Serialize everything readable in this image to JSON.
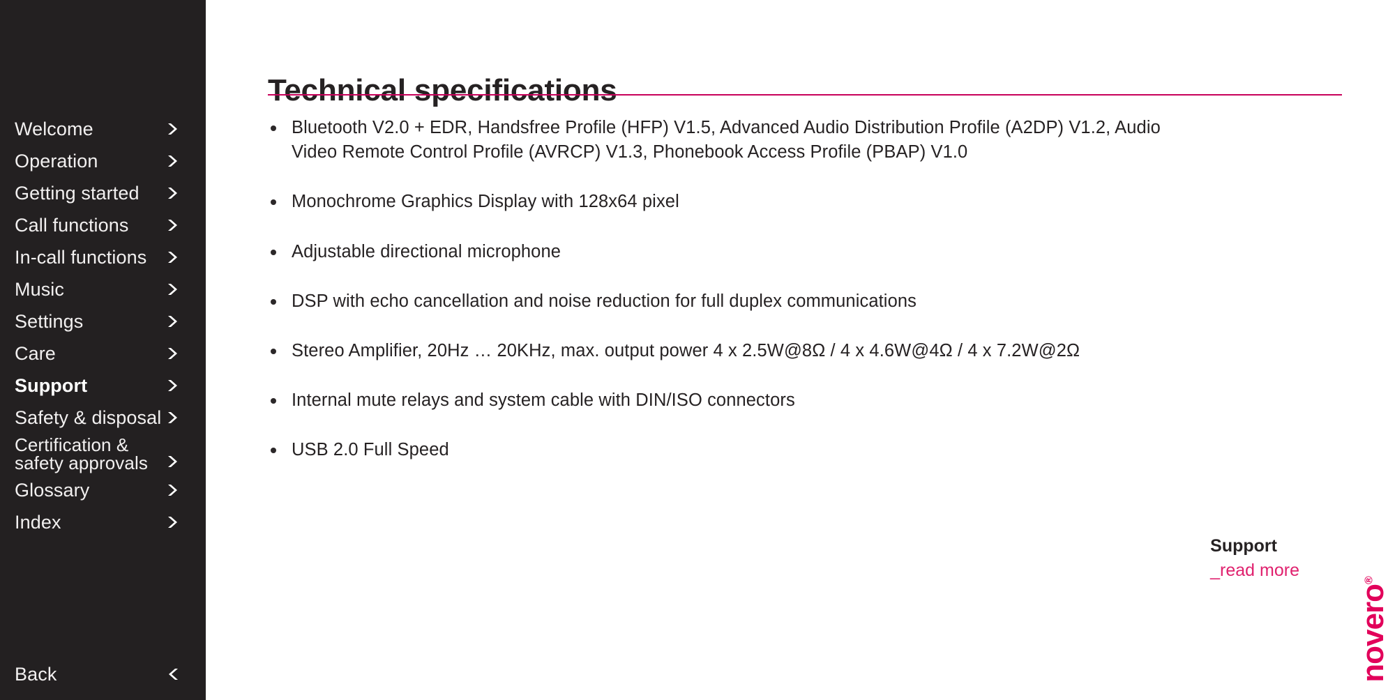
{
  "sidebar": {
    "background_color": "#232021",
    "items": [
      {
        "label": "Welcome",
        "icon": "chevron-right-icon",
        "active": false
      },
      {
        "label": "Operation",
        "icon": "chevron-right-icon",
        "active": false
      },
      {
        "label": "Getting started",
        "icon": "chevron-right-icon",
        "active": false
      },
      {
        "label": "Call functions",
        "icon": "chevron-right-icon",
        "active": false
      },
      {
        "label": "In-call functions",
        "icon": "chevron-right-icon",
        "active": false
      },
      {
        "label": "Music",
        "icon": "chevron-right-icon",
        "active": false
      },
      {
        "label": "Settings",
        "icon": "chevron-right-icon",
        "active": false
      },
      {
        "label": "Care",
        "icon": "chevron-right-icon",
        "active": false
      },
      {
        "label": "Support",
        "icon": "chevron-right-icon",
        "active": true
      },
      {
        "label": "Safety & disposal",
        "icon": "chevron-right-icon",
        "active": false
      },
      {
        "label": "Certification &\nsafety approvals",
        "icon": "chevron-right-icon",
        "active": false
      },
      {
        "label": "Glossary",
        "icon": "chevron-right-icon",
        "active": false
      },
      {
        "label": "Index",
        "icon": "chevron-right-icon",
        "active": false
      }
    ],
    "back": {
      "label": "Back",
      "icon": "chevron-left-icon"
    }
  },
  "main": {
    "title": "Technical specifications",
    "rule_color": "#c8005a",
    "specs": [
      "Bluetooth V2.0 + EDR, Handsfree Profile (HFP) V1.5, Advanced Audio Distribution Profile (A2DP) V1.2, Audio Video Remote Control Profile (AVRCP) V1.3, Phonebook Access Profile (PBAP) V1.0",
      "Monochrome Graphics Display with 128x64 pixel",
      "Adjustable directional microphone",
      "DSP with echo cancellation and noise reduction for full duplex communications",
      "Stereo Amplifier, 20Hz … 20KHz, max. output power 4 x 2.5W@8Ω / 4 x 4.6W@4Ω / 4 x 7.2W@2Ω",
      "Internal mute relays and system cable with DIN/ISO connectors",
      "USB 2.0 Full Speed"
    ]
  },
  "support_block": {
    "title": "Support",
    "read_more": "_read more",
    "link_color": "#e0216e"
  },
  "logo": {
    "text": "novero",
    "registered_mark": "®",
    "color": "#e2005a",
    "orientation": "rotated-90-ccw"
  }
}
